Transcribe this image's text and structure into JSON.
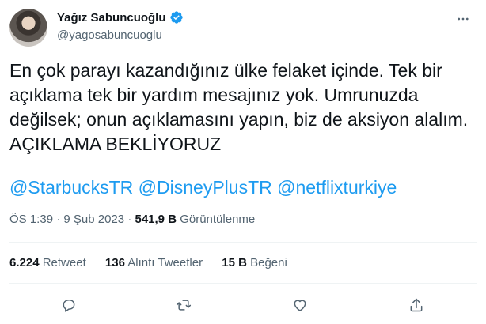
{
  "author": {
    "name": "Yağız Sabuncuoğlu",
    "handle": "@yagosabuncuoglu",
    "verified": true,
    "verified_color": "#1d9bf0"
  },
  "tweet": {
    "text": "En çok parayı kazandığınız ülke felaket içinde. Tek bir açıklama tek bir yardım mesajınız yok. Umrunuzda değilsek; onun açıklamasını yapın, biz de aksiyon alalım. AÇIKLAMA BEKLİYORUZ",
    "mentions": [
      "@StarbucksTR",
      "@DisneyPlusTR",
      "@netflixturkiye"
    ],
    "mention_color": "#1d9bf0"
  },
  "meta": {
    "time": "ÖS 1:39",
    "date": "9 Şub 2023",
    "views_count": "541,9 B",
    "views_label": "Görüntülenme"
  },
  "stats": {
    "retweets_count": "6.224",
    "retweets_label": "Retweet",
    "quotes_count": "136",
    "quotes_label": "Alıntı Tweetler",
    "likes_count": "15 B",
    "likes_label": "Beğeni"
  },
  "icons": {
    "more": "more-icon",
    "reply": "reply-icon",
    "retweet": "retweet-icon",
    "like": "heart-icon",
    "share": "share-icon"
  }
}
